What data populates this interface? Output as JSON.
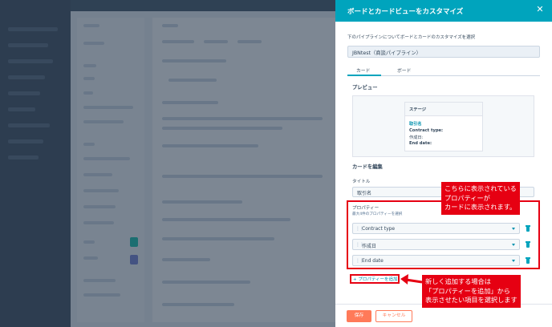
{
  "panel": {
    "title": "ボードとカードビューをカスタマイズ",
    "close_icon": "close-icon",
    "description": "下のパイプラインについてボードとカードのカスタマイズを選択",
    "pipeline_value": "JBNtest（商談パイプライン）",
    "tabs": [
      {
        "label": "カード",
        "active": true
      },
      {
        "label": "ボード",
        "active": false
      }
    ]
  },
  "preview": {
    "heading": "プレビュー",
    "card": {
      "stage": "ステージ",
      "name": "取引名",
      "lines": [
        "Contract type:",
        "作成日:",
        "End date:"
      ]
    }
  },
  "edit": {
    "heading": "カードを編集",
    "title_label": "タイトル",
    "title_value": "取引名",
    "properties_label": "プロパティー",
    "properties_sub": "最大4件のプロパティーを選択",
    "properties": [
      "Contract type",
      "作成日",
      "End date"
    ],
    "add_property": "+ プロパティーを追加"
  },
  "footer": {
    "save": "保存",
    "cancel": "キャンセル"
  },
  "annotations": {
    "callout_top": [
      "こちらに表示されている",
      "プロパティーが",
      "カードに表示されます。"
    ],
    "callout_bottom": [
      "新しく追加する場合は",
      "「プロパティーを追加」から",
      "表示させたい項目を選択します"
    ],
    "color": "#e60012"
  },
  "colors": {
    "accent": "#00a4bd",
    "primary_button": "#ff7a59",
    "text": "#33475b"
  }
}
